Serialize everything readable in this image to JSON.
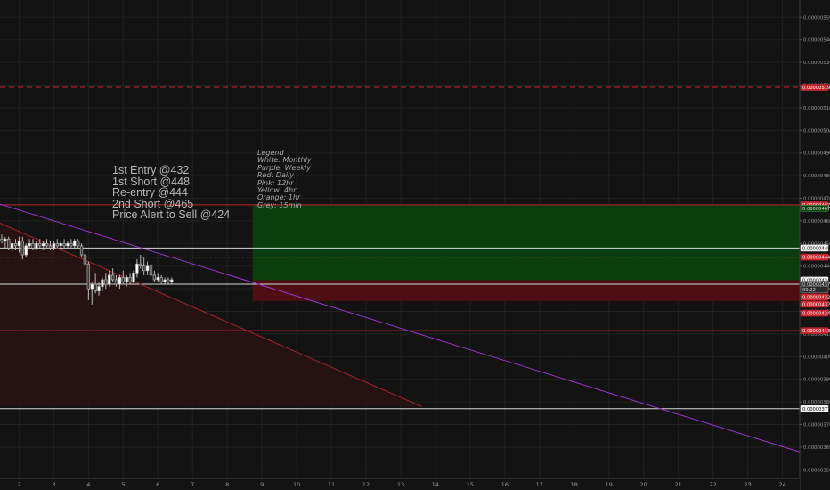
{
  "chart_data": {
    "type": "candlestick",
    "price_axis_ticks": [
      "0.00000550",
      "0.00000540",
      "0.00000530",
      "0.00000520",
      "0.00000510",
      "0.00000500",
      "0.00000490",
      "0.00000480",
      "0.00000470",
      "0.00000460",
      "0.00000450",
      "0.00000440",
      "0.00000430",
      "0.00000420",
      "0.00000410",
      "0.00000400",
      "0.00000390",
      "0.00000380",
      "0.00000370",
      "0.00000360",
      "0.00000350"
    ],
    "time_axis_ticks": [
      "2",
      "3",
      "4",
      "5",
      "6",
      "7",
      "8",
      "9",
      "10",
      "11",
      "12",
      "13",
      "14",
      "15",
      "16",
      "17",
      "18",
      "19",
      "20",
      "21",
      "22",
      "23",
      "24"
    ],
    "ylim": [
      3.462e-06,
      5.576e-06
    ],
    "xlim": [
      1.45,
      24.5
    ],
    "price_labels": [
      {
        "text": "0.00000519",
        "value": 5.19e-06,
        "style": "red"
      },
      {
        "text": "0.00000467",
        "value": 4.671e-06,
        "style": "red"
      },
      {
        "text": "0.00000467",
        "value": 4.655e-06,
        "style": "green"
      },
      {
        "text": "0.00000448",
        "value": 4.48e-06,
        "style": "white"
      },
      {
        "text": "0.00000444",
        "value": 4.44e-06,
        "style": "red"
      },
      {
        "text": "0.00000434",
        "value": 4.338e-06,
        "style": "white"
      },
      {
        "text": "0.00000437",
        "value": 4.32e-06,
        "style": "dark"
      },
      {
        "text": "09:22",
        "value": 4.296e-06,
        "style": "dark"
      },
      {
        "text": "0.00000432",
        "value": 4.264e-06,
        "style": "red"
      },
      {
        "text": "0.00000432",
        "value": 4.232e-06,
        "style": "red"
      },
      {
        "text": "0.00000424",
        "value": 4.192e-06,
        "style": "red"
      },
      {
        "text": "0.00000413",
        "value": 4.115e-06,
        "style": "red"
      },
      {
        "text": "0.00000377",
        "value": 3.77e-06,
        "style": "white"
      }
    ],
    "horizontal_lines": [
      {
        "value": 5.19e-06,
        "color": "#c8252c",
        "dash": "6,4",
        "x_from": 0
      },
      {
        "value": 4.671e-06,
        "color": "#c8252c",
        "dash": "",
        "x_from": 0
      },
      {
        "value": 4.48e-06,
        "color": "#d8d8d8",
        "dash": "",
        "x_from": 0
      },
      {
        "value": 4.44e-06,
        "color": "#e08a20",
        "dash": "2,2",
        "x_from": 0
      },
      {
        "value": 4.32e-06,
        "color": "#d8d8d8",
        "dash": "",
        "x_from": 0
      },
      {
        "value": 4.115e-06,
        "color": "#c8252c",
        "dash": "",
        "x_from": 0
      },
      {
        "value": 3.77e-06,
        "color": "#d8d8d8",
        "dash": "",
        "x_from": 0
      }
    ],
    "zones": [
      {
        "x_from": 8.73,
        "x_to": 24.5,
        "y_top": 4.671e-06,
        "y_bottom": 4.338e-06,
        "color": "#0c3d0e"
      },
      {
        "x_from": 8.73,
        "x_to": 24.5,
        "y_top": 4.338e-06,
        "y_bottom": 4.246e-06,
        "color": "#4d0f12"
      }
    ],
    "trendlines": [
      {
        "x1": 1.45,
        "y1": 4.674e-06,
        "x2": 24.5,
        "y2": 3.579e-06,
        "color": "#9b36c8"
      },
      {
        "x1": 1.45,
        "y1": 4.59e-06,
        "x2": 13.6,
        "y2": 3.78e-06,
        "color": "#a4262b"
      }
    ],
    "shaded_triangle": {
      "points": [
        [
          1.45,
          4.59e-06
        ],
        [
          13.6,
          3.78e-06
        ],
        [
          1.45,
          3.78e-06
        ]
      ],
      "color": "#2a1214"
    },
    "candles": [
      {
        "x": 1.5,
        "o": 4.52,
        "h": 4.54,
        "l": 4.5,
        "c": 4.51
      },
      {
        "x": 1.6,
        "o": 4.51,
        "h": 4.53,
        "l": 4.48,
        "c": 4.52
      },
      {
        "x": 1.7,
        "o": 4.52,
        "h": 4.53,
        "l": 4.47,
        "c": 4.48
      },
      {
        "x": 1.8,
        "o": 4.48,
        "h": 4.51,
        "l": 4.46,
        "c": 4.5
      },
      {
        "x": 1.9,
        "o": 4.5,
        "h": 4.52,
        "l": 4.47,
        "c": 4.49
      },
      {
        "x": 2.0,
        "o": 4.49,
        "h": 4.53,
        "l": 4.46,
        "c": 4.51
      },
      {
        "x": 2.1,
        "o": 4.51,
        "h": 4.53,
        "l": 4.43,
        "c": 4.45
      },
      {
        "x": 2.2,
        "o": 4.45,
        "h": 4.5,
        "l": 4.44,
        "c": 4.49
      },
      {
        "x": 2.3,
        "o": 4.49,
        "h": 4.52,
        "l": 4.48,
        "c": 4.5
      },
      {
        "x": 2.4,
        "o": 4.5,
        "h": 4.52,
        "l": 4.47,
        "c": 4.48
      },
      {
        "x": 2.5,
        "o": 4.48,
        "h": 4.51,
        "l": 4.47,
        "c": 4.5
      },
      {
        "x": 2.6,
        "o": 4.5,
        "h": 4.52,
        "l": 4.48,
        "c": 4.49
      },
      {
        "x": 2.7,
        "o": 4.49,
        "h": 4.51,
        "l": 4.47,
        "c": 4.5
      },
      {
        "x": 2.8,
        "o": 4.5,
        "h": 4.52,
        "l": 4.48,
        "c": 4.49
      },
      {
        "x": 2.9,
        "o": 4.49,
        "h": 4.51,
        "l": 4.47,
        "c": 4.48
      },
      {
        "x": 3.0,
        "o": 4.48,
        "h": 4.51,
        "l": 4.47,
        "c": 4.5
      },
      {
        "x": 3.1,
        "o": 4.5,
        "h": 4.52,
        "l": 4.48,
        "c": 4.49
      },
      {
        "x": 3.2,
        "o": 4.49,
        "h": 4.51,
        "l": 4.47,
        "c": 4.5
      },
      {
        "x": 3.3,
        "o": 4.5,
        "h": 4.52,
        "l": 4.48,
        "c": 4.49
      },
      {
        "x": 3.4,
        "o": 4.49,
        "h": 4.51,
        "l": 4.48,
        "c": 4.5
      },
      {
        "x": 3.5,
        "o": 4.5,
        "h": 4.52,
        "l": 4.48,
        "c": 4.49
      },
      {
        "x": 3.6,
        "o": 4.49,
        "h": 4.52,
        "l": 4.48,
        "c": 4.51
      },
      {
        "x": 3.7,
        "o": 4.51,
        "h": 4.52,
        "l": 4.48,
        "c": 4.49
      },
      {
        "x": 3.8,
        "o": 4.49,
        "h": 4.5,
        "l": 4.44,
        "c": 4.45
      },
      {
        "x": 3.9,
        "o": 4.45,
        "h": 4.46,
        "l": 4.4,
        "c": 4.41
      },
      {
        "x": 4.0,
        "o": 4.41,
        "h": 4.42,
        "l": 4.25,
        "c": 4.3
      },
      {
        "x": 4.1,
        "o": 4.3,
        "h": 4.33,
        "l": 4.23,
        "c": 4.32
      },
      {
        "x": 4.2,
        "o": 4.32,
        "h": 4.37,
        "l": 4.28,
        "c": 4.29
      },
      {
        "x": 4.3,
        "o": 4.29,
        "h": 4.33,
        "l": 4.27,
        "c": 4.31
      },
      {
        "x": 4.4,
        "o": 4.31,
        "h": 4.35,
        "l": 4.29,
        "c": 4.34
      },
      {
        "x": 4.5,
        "o": 4.34,
        "h": 4.37,
        "l": 4.3,
        "c": 4.32
      },
      {
        "x": 4.6,
        "o": 4.32,
        "h": 4.38,
        "l": 4.31,
        "c": 4.36
      },
      {
        "x": 4.7,
        "o": 4.36,
        "h": 4.39,
        "l": 4.33,
        "c": 4.34
      },
      {
        "x": 4.8,
        "o": 4.34,
        "h": 4.36,
        "l": 4.31,
        "c": 4.32
      },
      {
        "x": 4.9,
        "o": 4.32,
        "h": 4.36,
        "l": 4.3,
        "c": 4.35
      },
      {
        "x": 5.0,
        "o": 4.35,
        "h": 4.38,
        "l": 4.32,
        "c": 4.33
      },
      {
        "x": 5.1,
        "o": 4.33,
        "h": 4.36,
        "l": 4.31,
        "c": 4.35
      },
      {
        "x": 5.2,
        "o": 4.35,
        "h": 4.37,
        "l": 4.32,
        "c": 4.33
      },
      {
        "x": 5.3,
        "o": 4.33,
        "h": 4.38,
        "l": 4.32,
        "c": 4.37
      },
      {
        "x": 5.4,
        "o": 4.37,
        "h": 4.43,
        "l": 4.35,
        "c": 4.41
      },
      {
        "x": 5.5,
        "o": 4.41,
        "h": 4.45,
        "l": 4.39,
        "c": 4.4
      },
      {
        "x": 5.6,
        "o": 4.4,
        "h": 4.44,
        "l": 4.36,
        "c": 4.38
      },
      {
        "x": 5.7,
        "o": 4.38,
        "h": 4.42,
        "l": 4.36,
        "c": 4.4
      },
      {
        "x": 5.8,
        "o": 4.4,
        "h": 4.41,
        "l": 4.35,
        "c": 4.36
      },
      {
        "x": 5.9,
        "o": 4.36,
        "h": 4.38,
        "l": 4.33,
        "c": 4.34
      },
      {
        "x": 6.0,
        "o": 4.34,
        "h": 4.37,
        "l": 4.33,
        "c": 4.35
      },
      {
        "x": 6.1,
        "o": 4.35,
        "h": 4.36,
        "l": 4.32,
        "c": 4.33
      },
      {
        "x": 6.2,
        "o": 4.33,
        "h": 4.35,
        "l": 4.32,
        "c": 4.34
      },
      {
        "x": 6.3,
        "o": 4.34,
        "h": 4.35,
        "l": 4.32,
        "c": 4.33
      },
      {
        "x": 6.4,
        "o": 4.33,
        "h": 4.35,
        "l": 4.32,
        "c": 4.34
      }
    ]
  },
  "notes": [
    "1st Entry @432",
    "1st Short @448",
    "Re-entry @444",
    "2nd Short @465",
    "Price Alert to Sell @424"
  ],
  "legend": [
    "Legend",
    "White: Monthly",
    "Purple: Weekly",
    "Red: Daily",
    "Pink: 12hr",
    "Yellow: 4hr",
    "Orange: 1hr",
    "Grey: 15min"
  ],
  "colors": {
    "background": "#131313",
    "grid": "#202020",
    "axis_text": "#9a9a9a",
    "bull": "#ffffff",
    "bear": "#3a3a3a",
    "wick": "#bdbdbd"
  }
}
